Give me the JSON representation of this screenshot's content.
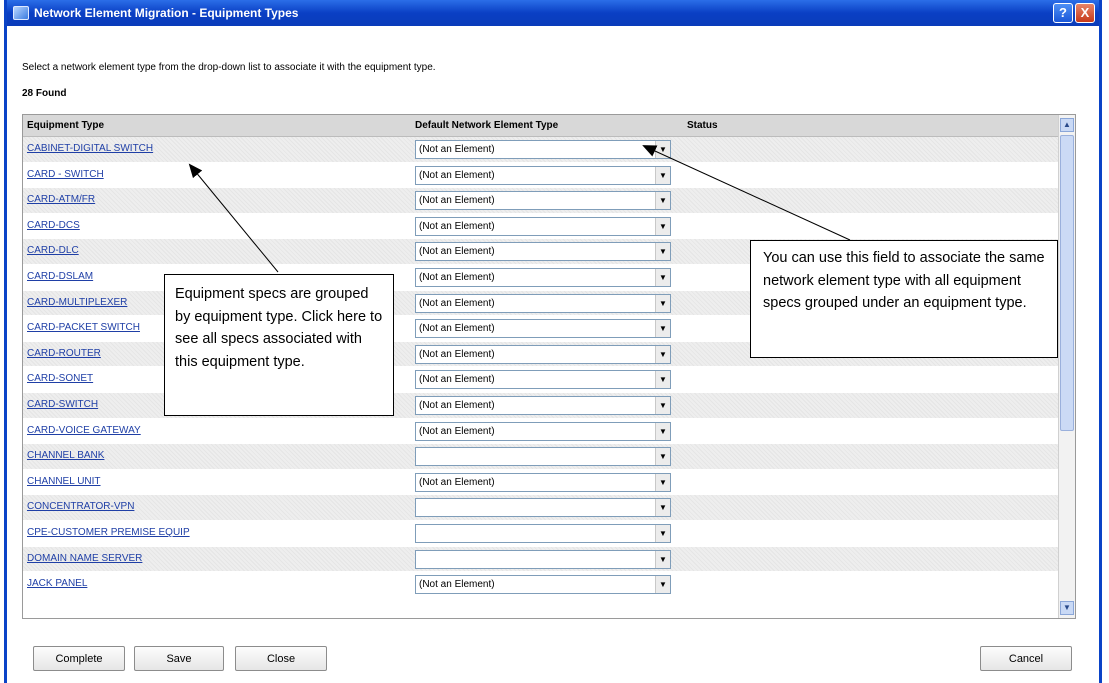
{
  "window": {
    "title": "Network Element Migration - Equipment Types",
    "help_label": "?",
    "close_label": "X"
  },
  "instruction": "Select a network element type from the drop-down list to associate it with the equipment type.",
  "found_count": "28 Found",
  "table": {
    "headers": [
      "Equipment Type",
      "Default Network Element Type",
      "Status"
    ],
    "rows": [
      {
        "equipment_type": "CABINET-DIGITAL SWITCH",
        "default_type": "(Not an Element)"
      },
      {
        "equipment_type": "CARD - SWITCH",
        "default_type": "(Not an Element)"
      },
      {
        "equipment_type": "CARD-ATM/FR",
        "default_type": "(Not an Element)"
      },
      {
        "equipment_type": "CARD-DCS",
        "default_type": "(Not an Element)"
      },
      {
        "equipment_type": "CARD-DLC",
        "default_type": "(Not an Element)"
      },
      {
        "equipment_type": "CARD-DSLAM",
        "default_type": "(Not an Element)"
      },
      {
        "equipment_type": "CARD-MULTIPLEXER",
        "default_type": "(Not an Element)"
      },
      {
        "equipment_type": "CARD-PACKET SWITCH",
        "default_type": "(Not an Element)"
      },
      {
        "equipment_type": "CARD-ROUTER",
        "default_type": "(Not an Element)"
      },
      {
        "equipment_type": "CARD-SONET",
        "default_type": "(Not an Element)"
      },
      {
        "equipment_type": "CARD-SWITCH",
        "default_type": "(Not an Element)"
      },
      {
        "equipment_type": "CARD-VOICE GATEWAY",
        "default_type": "(Not an Element)"
      },
      {
        "equipment_type": "CHANNEL BANK",
        "default_type": ""
      },
      {
        "equipment_type": "CHANNEL UNIT",
        "default_type": "(Not an Element)"
      },
      {
        "equipment_type": "CONCENTRATOR-VPN",
        "default_type": ""
      },
      {
        "equipment_type": "CPE-CUSTOMER PREMISE EQUIP",
        "default_type": ""
      },
      {
        "equipment_type": "DOMAIN NAME SERVER",
        "default_type": ""
      },
      {
        "equipment_type": "JACK PANEL",
        "default_type": "(Not an Element)"
      }
    ]
  },
  "callouts": {
    "left": "Equipment specs are grouped by equipment type. Click here to see all specs associated with this equipment type.",
    "right": "You can use this field to associate the same network element type with all equipment specs grouped under an equipment type."
  },
  "buttons": {
    "complete": "Complete",
    "save": "Save",
    "close": "Close",
    "cancel": "Cancel"
  },
  "icons": {
    "dropdown": "chevron-down-icon",
    "scroll_up": "chevron-up-icon",
    "scroll_down": "chevron-down-icon"
  }
}
